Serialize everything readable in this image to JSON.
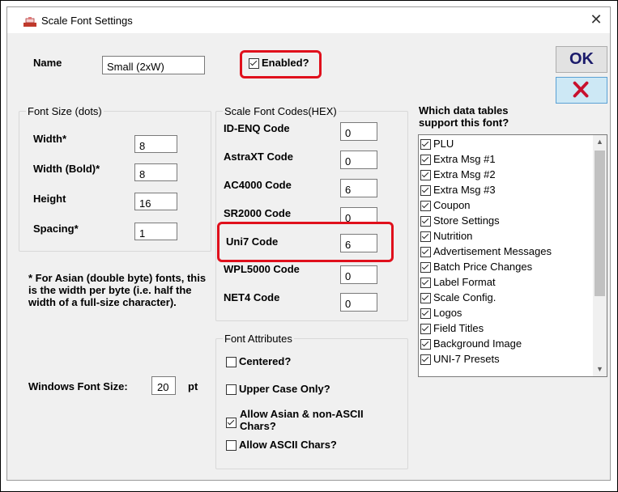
{
  "window": {
    "title": "Scale Font Settings",
    "close_glyph": "✕"
  },
  "name_field": {
    "label": "Name",
    "value": "Small (2xW)"
  },
  "enabled": {
    "label": "Enabled?",
    "checked": true
  },
  "buttons": {
    "ok_label": "OK",
    "cancel_icon": "red-x-icon"
  },
  "font_size": {
    "title": "Font Size (dots)",
    "width": {
      "label": "Width*",
      "value": "8"
    },
    "width_bold": {
      "label": "Width (Bold)*",
      "value": "8"
    },
    "height": {
      "label": "Height",
      "value": "16"
    },
    "spacing": {
      "label": "Spacing*",
      "value": "1"
    }
  },
  "footnote": "* For Asian (double byte) fonts, this is the width per byte (i.e. half the width of a full-size character).",
  "windows_font": {
    "label": "Windows Font Size:",
    "value": "20",
    "unit": "pt"
  },
  "codes": {
    "title": "Scale Font Codes(HEX)",
    "items": [
      {
        "label": "ID-ENQ Code",
        "value": "0"
      },
      {
        "label": "AstraXT Code",
        "value": "0"
      },
      {
        "label": "AC4000 Code",
        "value": "6"
      },
      {
        "label": "SR2000 Code",
        "value": "0"
      },
      {
        "label": "Uni7 Code",
        "value": "6"
      },
      {
        "label": "WPL5000 Code",
        "value": "0"
      },
      {
        "label": "NET4 Code",
        "value": "0"
      }
    ]
  },
  "attributes": {
    "title": "Font Attributes",
    "centered": {
      "label": "Centered?",
      "checked": false
    },
    "upper_case": {
      "label": "Upper Case Only?",
      "checked": false
    },
    "allow_asian_1": "Allow Asian & non-ASCII",
    "allow_asian_2": "Chars?",
    "allow_asian_checked": true,
    "allow_ascii": {
      "label": "Allow ASCII Chars?",
      "checked": false
    }
  },
  "tables": {
    "heading_1": "Which data tables",
    "heading_2": "support this font?",
    "items": [
      "PLU",
      "Extra Msg #1",
      "Extra Msg #2",
      "Extra Msg #3",
      "Coupon",
      "Store Settings",
      "Nutrition",
      "Advertisement Messages",
      "Batch Price Changes",
      "Label Format",
      "Scale Config.",
      "Logos",
      "Field Titles",
      "Background Image",
      "UNI-7 Presets"
    ]
  },
  "colors": {
    "highlight": "#e0101c",
    "ok_text": "#1b1b6b",
    "cancel_x": "#c8102e"
  }
}
